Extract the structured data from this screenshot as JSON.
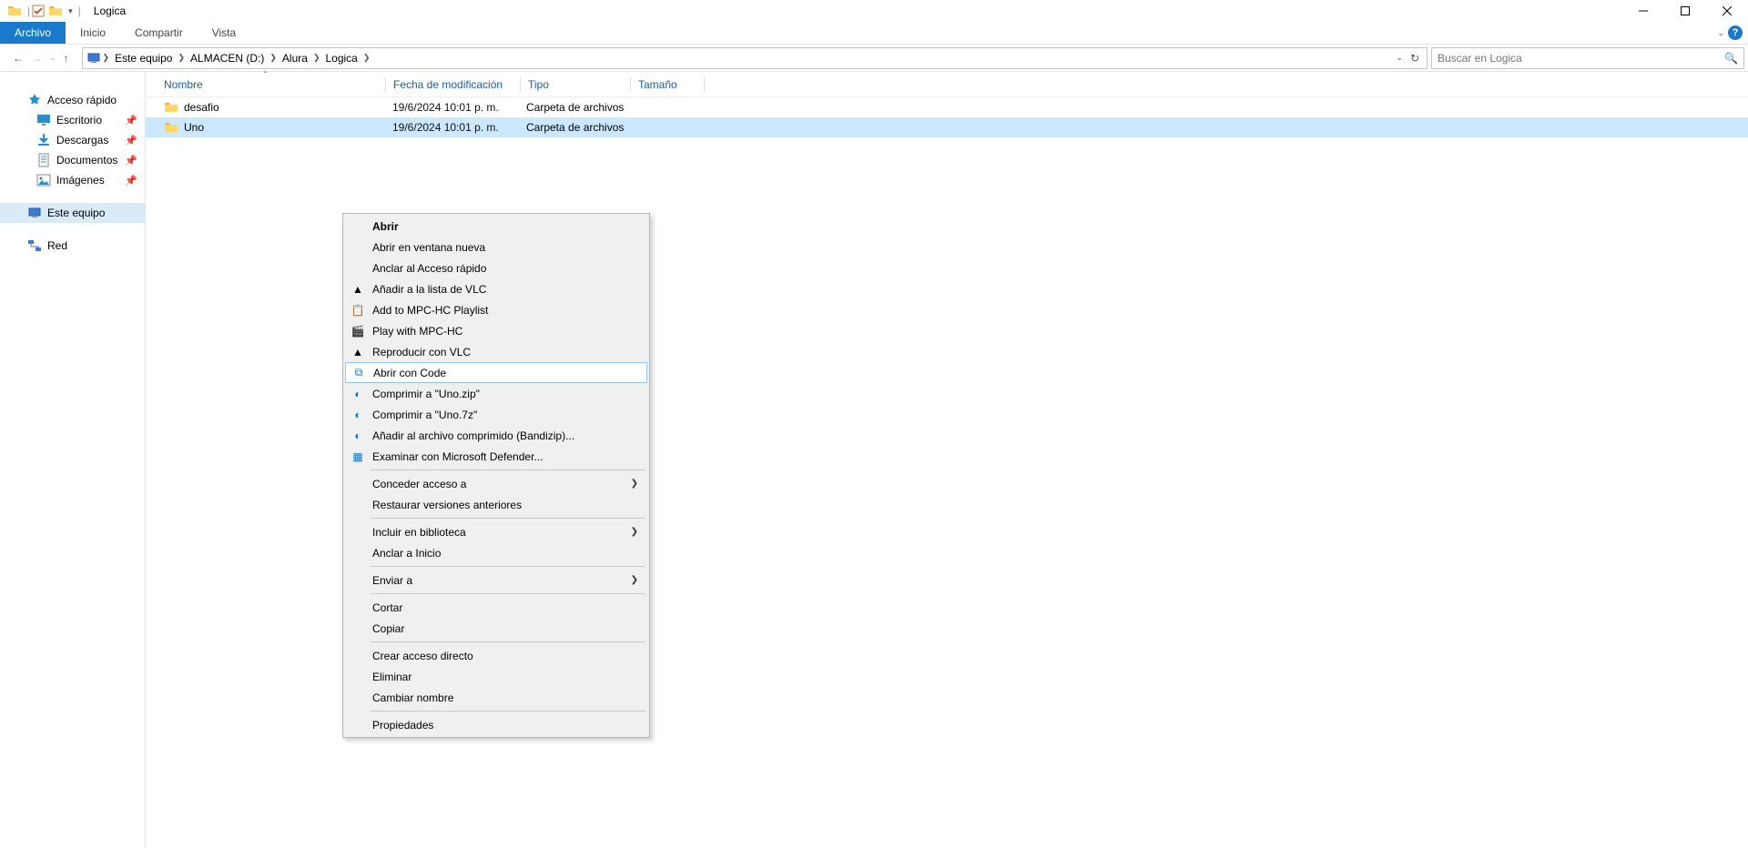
{
  "window": {
    "title": "Logica"
  },
  "ribbon": {
    "file": "Archivo",
    "tabs": [
      "Inicio",
      "Compartir",
      "Vista"
    ]
  },
  "breadcrumbs": [
    "Este equipo",
    "ALMACEN (D:)",
    "Alura",
    "Logica"
  ],
  "search": {
    "placeholder": "Buscar en Logica"
  },
  "sidebar": {
    "quick": {
      "label": "Acceso rápido"
    },
    "pinned": [
      {
        "label": "Escritorio"
      },
      {
        "label": "Descargas"
      },
      {
        "label": "Documentos"
      },
      {
        "label": "Imágenes"
      }
    ],
    "thispc": {
      "label": "Este equipo"
    },
    "network": {
      "label": "Red"
    }
  },
  "columns": {
    "name": "Nombre",
    "date": "Fecha de modificación",
    "type": "Tipo",
    "size": "Tamaño"
  },
  "rows": [
    {
      "name": "desafio",
      "date": "19/6/2024 10:01 p. m.",
      "type": "Carpeta de archivos",
      "size": ""
    },
    {
      "name": "Uno",
      "date": "19/6/2024 10:01 p. m.",
      "type": "Carpeta de archivos",
      "size": ""
    }
  ],
  "ctx": {
    "abrir": "Abrir",
    "abrir_ventana": "Abrir en ventana nueva",
    "anclar_rapido": "Anclar al Acceso rápido",
    "vlc_add": "Añadir a la lista de VLC",
    "mpc_add": "Add to MPC-HC Playlist",
    "mpc_play": "Play with MPC-HC",
    "vlc_play": "Reproducir con VLC",
    "code": "Abrir con Code",
    "zip": "Comprimir a \"Uno.zip\"",
    "sevenz": "Comprimir a \"Uno.7z\"",
    "bandizip": "Añadir al archivo comprimido (Bandizip)...",
    "defender": "Examinar con Microsoft Defender...",
    "conceder": "Conceder acceso a",
    "restaurar": "Restaurar versiones anteriores",
    "biblioteca": "Incluir en biblioteca",
    "anclar_inicio": "Anclar a Inicio",
    "enviar": "Enviar a",
    "cortar": "Cortar",
    "copiar": "Copiar",
    "acceso_directo": "Crear acceso directo",
    "eliminar": "Eliminar",
    "renombrar": "Cambiar nombre",
    "propiedades": "Propiedades"
  }
}
